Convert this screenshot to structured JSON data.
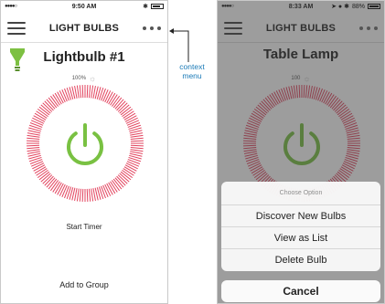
{
  "left_screen": {
    "status": {
      "time": "9:50 AM",
      "signal": "●●●●○",
      "bluetooth": "✱"
    },
    "nav": {
      "title": "LIGHT BULBS"
    },
    "bulb": {
      "name": "Lightbulb #1",
      "brightness": "100%"
    },
    "actions": {
      "timer": "Start Timer",
      "group": "Add to Group"
    }
  },
  "right_screen": {
    "status": {
      "time": "8:33 AM",
      "signal": "●●●●○",
      "icons": "➤ ● ✱",
      "battery": "88%"
    },
    "nav": {
      "title": "LIGHT BULBS"
    },
    "bulb": {
      "name": "Table Lamp",
      "brightness": "100"
    },
    "sheet": {
      "title": "Choose Option",
      "options": [
        "Discover New Bulbs",
        "View as List",
        "Delete Bulb"
      ],
      "cancel": "Cancel"
    }
  },
  "annotation": {
    "line1": "context",
    "line2": "menu"
  },
  "colors": {
    "ring": "#e2435e",
    "power": "#79c142",
    "bulb": "#7dc042",
    "annotation": "#1a7ab7"
  }
}
